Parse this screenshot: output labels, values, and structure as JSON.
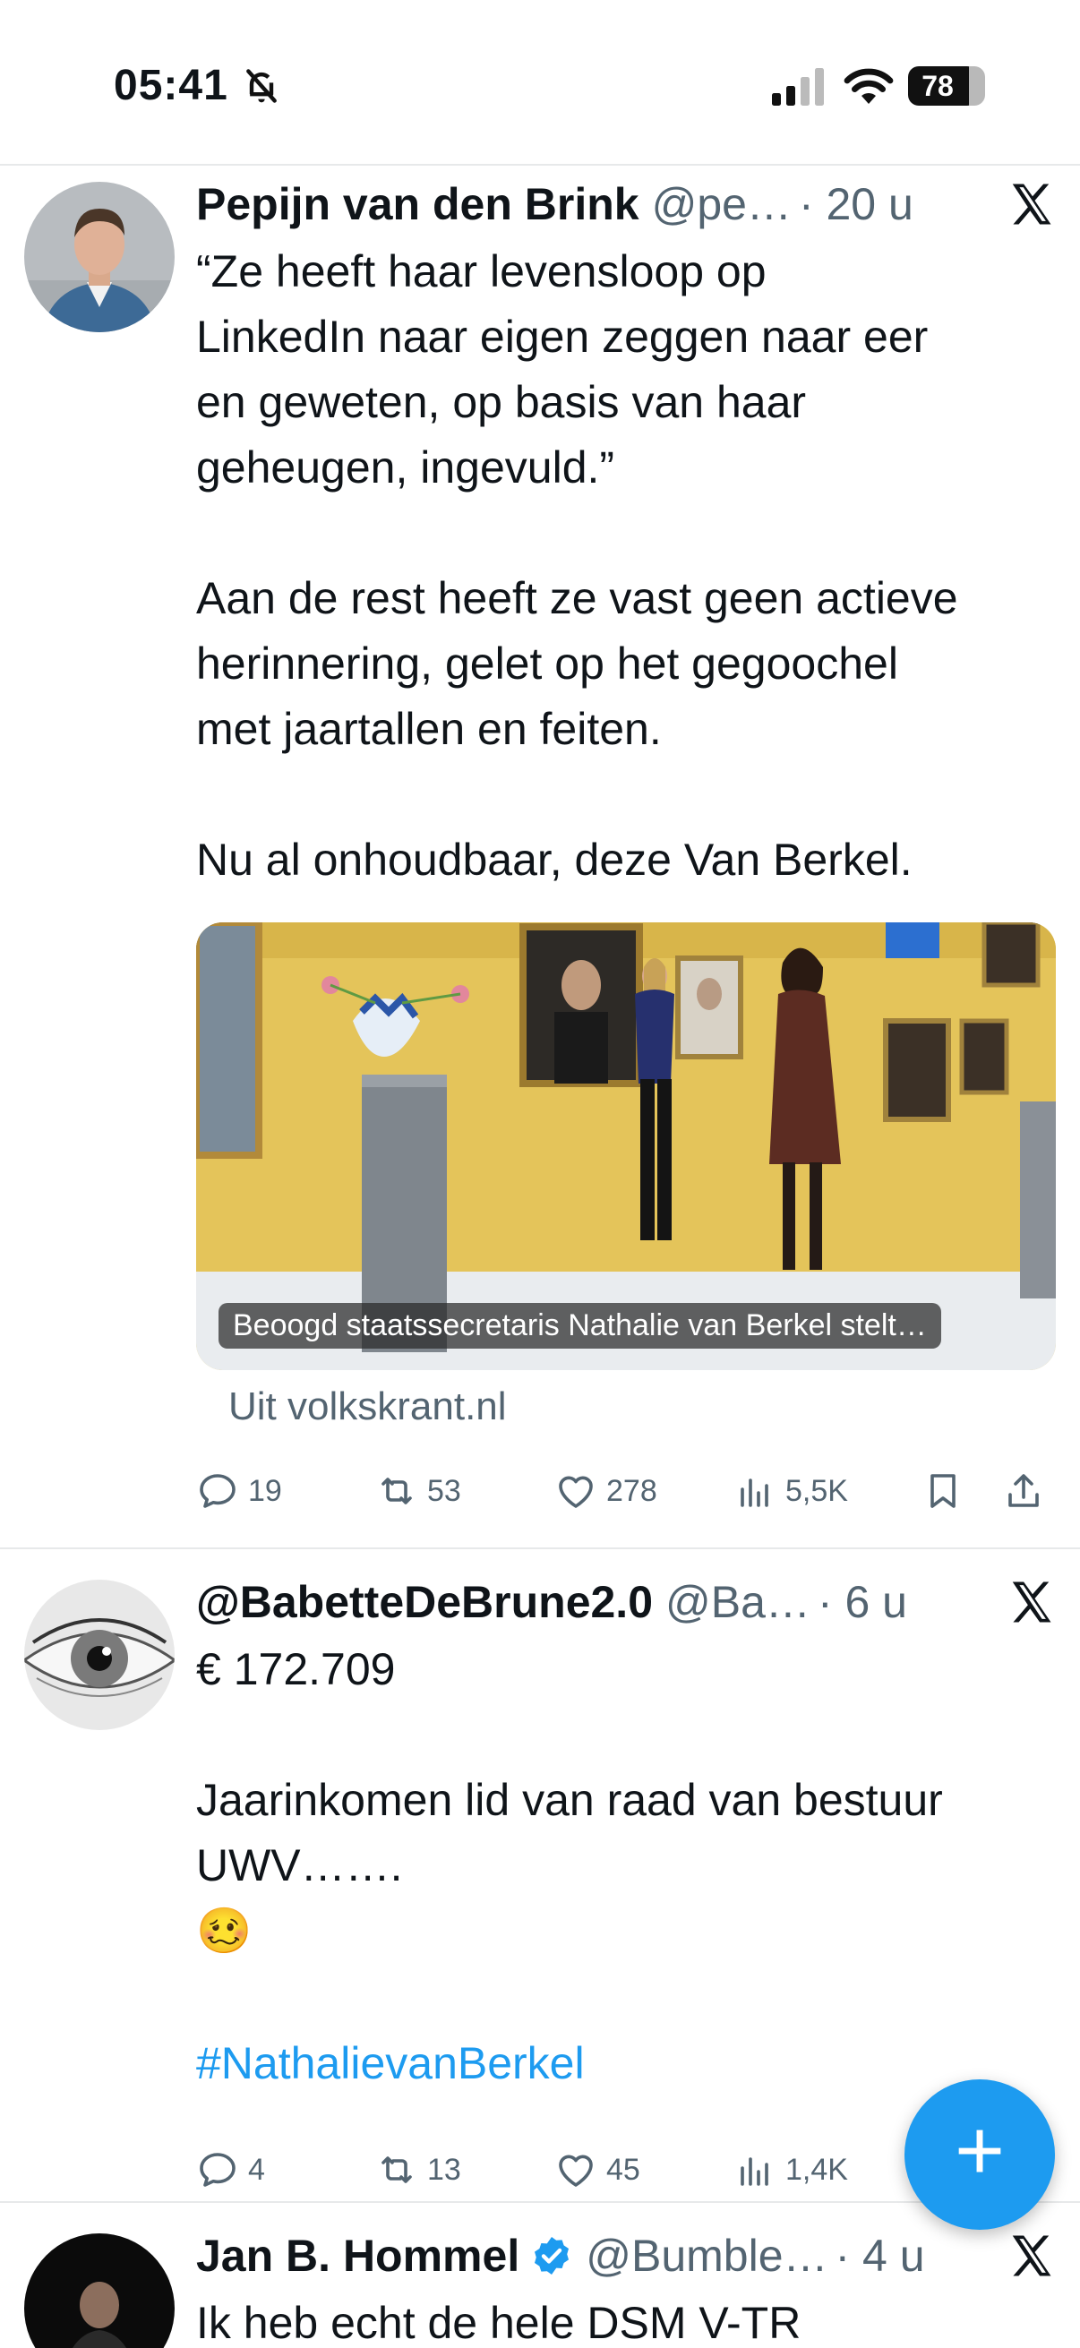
{
  "status_bar": {
    "time": "05:41",
    "battery": "78"
  },
  "tweets": [
    {
      "name": "Pepijn van den Brink",
      "handle": "@pe…",
      "time": "· 20 u",
      "text": "“Ze heeft haar levensloop op\nLinkedIn naar eigen zeggen naar eer\nen geweten, op basis van haar\ngeheugen, ingevuld.”\n\nAan de rest heeft ze vast geen actieve\nherinnering, gelet op het gegoochel\nmet jaartallen en feiten.\n\nNu al onhoudbaar, deze Van Berkel.",
      "card_caption": "Beoogd staatssecretaris Nathalie van Berkel stelt…",
      "card_source": "Uit volkskrant.nl",
      "replies": "19",
      "reposts": "53",
      "likes": "278",
      "views": "5,5K"
    },
    {
      "name": "@BabetteDeBrune2.0",
      "handle": "@Ba…",
      "time": "· 6 u",
      "text": "€ 172.709\n\nJaarinkomen lid van raad van bestuur\nUWV…….\n🥴",
      "hashtag": "#NathalievanBerkel",
      "replies": "4",
      "reposts": "13",
      "likes": "45",
      "views": "1,4K"
    },
    {
      "name": "Jan B. Hommel",
      "handle": "@Bumble…",
      "time": "· 4 u",
      "text": "Ik heb echt de hele DSM V-TR"
    }
  ],
  "fab": {
    "label": "+"
  },
  "colors": {
    "accent": "#1d9bf0",
    "secondary_text": "#536471",
    "divider": "#e7e9ea"
  }
}
